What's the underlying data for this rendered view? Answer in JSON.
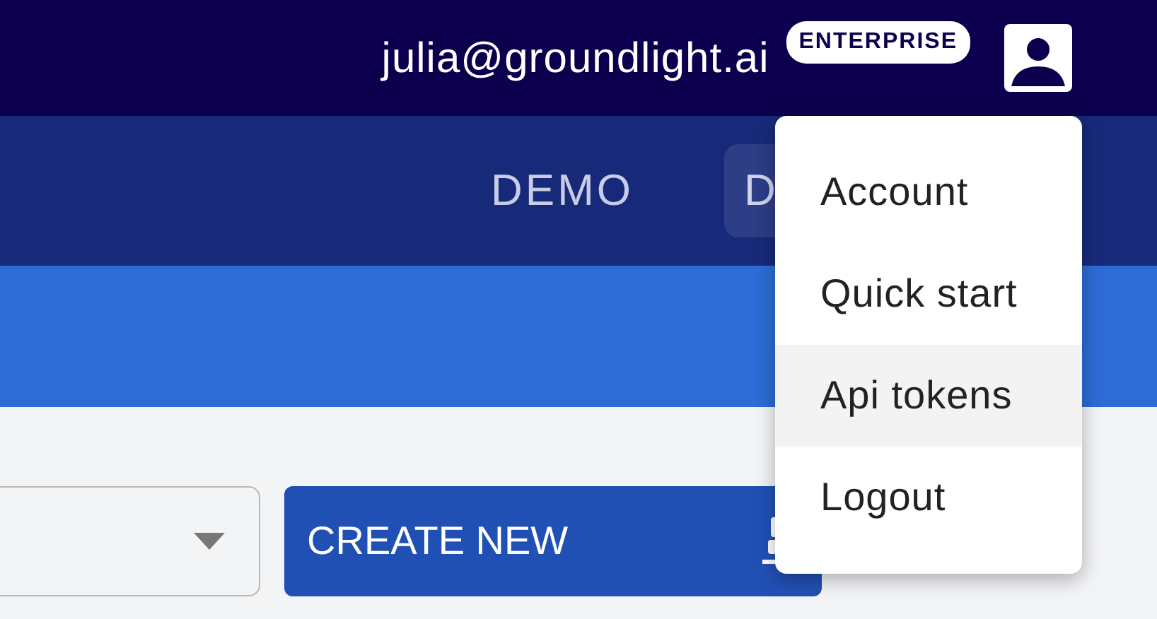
{
  "header": {
    "email": "julia@groundlight.ai",
    "badge": "ENTERPRISE"
  },
  "nav_tabs": [
    {
      "label": "DEMO",
      "selected": false
    },
    {
      "label": "D",
      "selected": true
    }
  ],
  "create_button": {
    "label": "CREATE NEW"
  },
  "user_menu": [
    {
      "label": "Account",
      "selected": false
    },
    {
      "label": "Quick start",
      "selected": false
    },
    {
      "label": "Api tokens",
      "selected": true
    },
    {
      "label": "Logout",
      "selected": false
    }
  ]
}
